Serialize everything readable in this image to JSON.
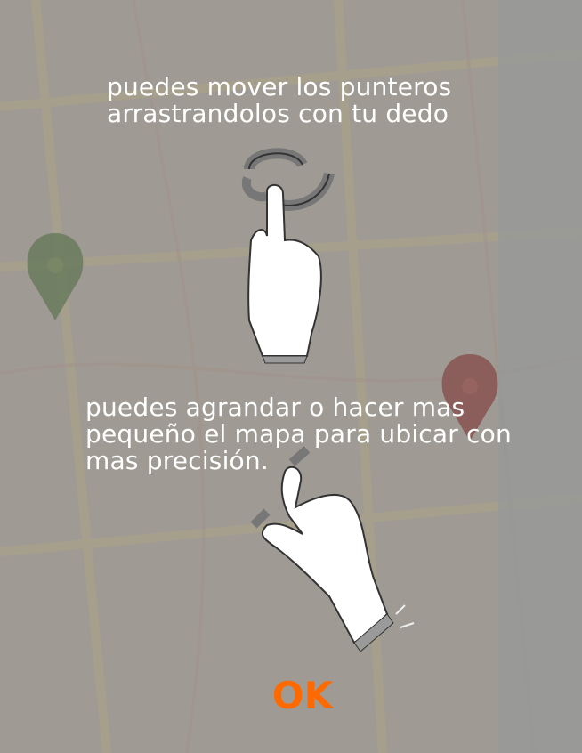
{
  "tutorial": {
    "drag_text": "puedes mover los punteros arrastrandolos con tu dedo",
    "zoom_text": "puedes agrandar o hacer mas pequeño el mapa para ubicar con mas precisión.",
    "ok_label": "OK"
  },
  "colors": {
    "accent": "#ff6a00",
    "overlay": "#787673",
    "green_marker": "#4f7d3a",
    "red_marker": "#9b2a2a"
  },
  "icons": [
    "drag-gesture-icon",
    "pinch-zoom-icon",
    "map-marker-icon"
  ]
}
